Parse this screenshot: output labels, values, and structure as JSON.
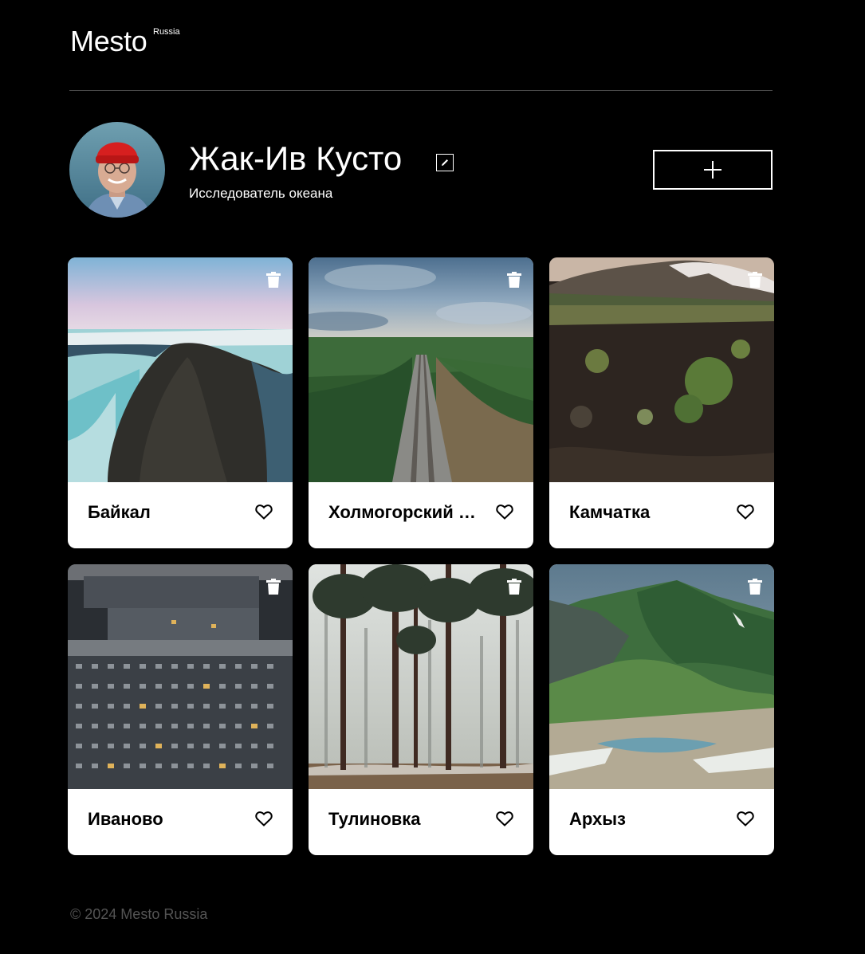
{
  "header": {
    "logo": "Mesto",
    "logo_sub": "Russia"
  },
  "profile": {
    "name": "Жак-Ив Кусто",
    "about": "Исследователь океана",
    "edit_icon": "pencil-icon",
    "add_icon": "plus-icon"
  },
  "cards": [
    {
      "title": "Байкал",
      "image": "rocky cliff by frozen lake"
    },
    {
      "title": "Холмогорский район",
      "image": "railway through forest"
    },
    {
      "title": "Камчатка",
      "image": "volcanic tundra with mountains"
    },
    {
      "title": "Иваново",
      "image": "apartment blocks at dusk"
    },
    {
      "title": "Тулиновка",
      "image": "foggy pine forest"
    },
    {
      "title": "Архыз",
      "image": "green mountains with snow"
    }
  ],
  "footer": {
    "copyright": "© 2024 Mesto Russia"
  }
}
